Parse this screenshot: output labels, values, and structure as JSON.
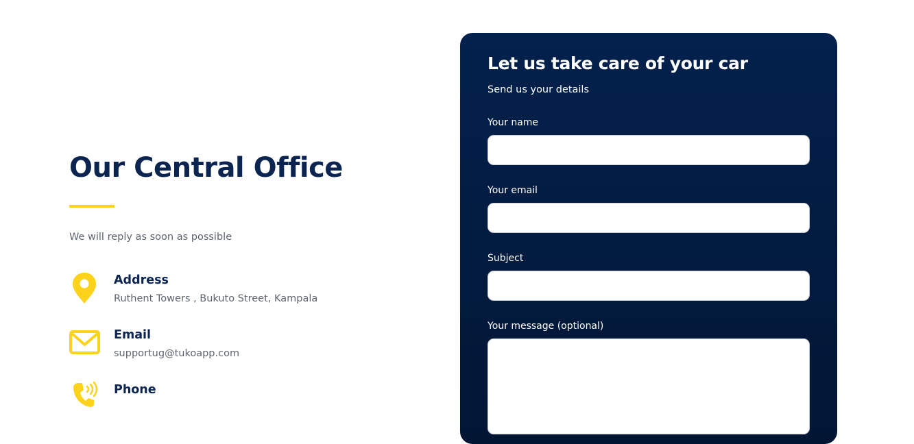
{
  "office": {
    "title": "Our Central Office",
    "subtitle": "We will reply as soon as possible",
    "accent_color": "#fcd21b",
    "title_color": "#0b2550",
    "contacts": [
      {
        "icon": "location-pin-icon",
        "label": "Address",
        "value": "Ruthent Towers , Bukuto Street, Kampala"
      },
      {
        "icon": "mail-icon",
        "label": "Email",
        "value": "supportug@tukoapp.com"
      },
      {
        "icon": "phone-icon",
        "label": "Phone",
        "value": ""
      }
    ]
  },
  "form": {
    "title": "Let us take care of your car",
    "subtitle": "Send us your details",
    "background_color": "#03214d",
    "fields": {
      "name": {
        "label": "Your name",
        "value": ""
      },
      "email": {
        "label": "Your email",
        "value": ""
      },
      "subject": {
        "label": "Subject",
        "value": ""
      },
      "message": {
        "label": "Your message (optional)",
        "value": ""
      }
    }
  }
}
